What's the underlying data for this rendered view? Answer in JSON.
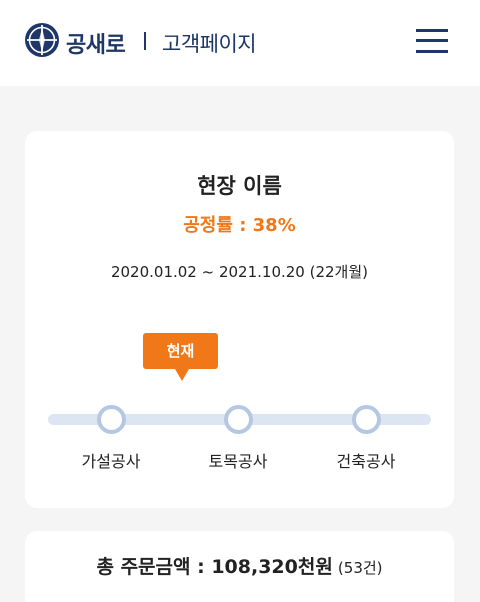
{
  "header": {
    "brand": "공새로",
    "subtitle": "고객페이지",
    "logo_icon": "compass-logo-icon",
    "menu_icon": "hamburger-menu-icon"
  },
  "site": {
    "name": "현장 이름",
    "progress_text": "공정률 : 38%",
    "progress_percent": 38,
    "period": "2020.01.02 ~ 2021.10.20 (22개월)"
  },
  "timeline": {
    "current_label": "현재",
    "stages": [
      {
        "label": "가설공사"
      },
      {
        "label": "토목공사"
      },
      {
        "label": "건축공사"
      }
    ]
  },
  "summary": {
    "total_label": "총 주문금액 : 108,320천원",
    "count_label": "(53건)"
  },
  "colors": {
    "brand_navy": "#1e3668",
    "accent_orange": "#f07818",
    "track": "#dce5f2",
    "node_border": "#b6c8e1",
    "page_bg": "#f5f5f5"
  }
}
